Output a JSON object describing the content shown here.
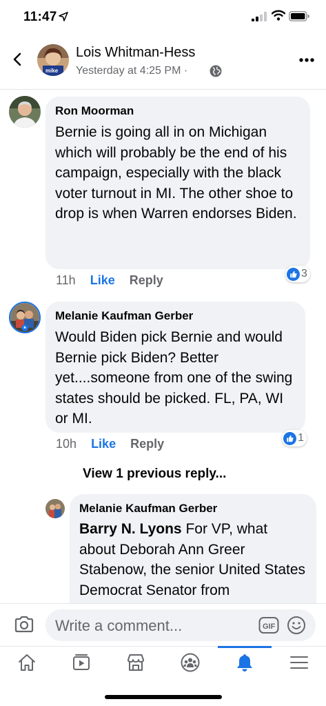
{
  "status_bar": {
    "time": "11:47"
  },
  "header": {
    "name": "Lois Whitman-Hess",
    "meta": "Yesterday at 4:25 PM ·",
    "avatar_caption": "mike"
  },
  "comments": [
    {
      "author": "Ron Moorman",
      "text": "Bernie is going all in on Michigan which will probably be the end of his campaign, especially with the black voter turnout in MI. The other shoe to\ndrop is when Warren endorses Biden.",
      "time": "11h",
      "like_label": "Like",
      "reply_label": "Reply",
      "reactions": "3"
    },
    {
      "author": "Melanie Kaufman Gerber",
      "text": "Would Biden pick Bernie and would Bernie pick Biden?  Better yet....someone from one of the swing states should be picked. FL, PA, WI or MI.",
      "time": "10h",
      "like_label": "Like",
      "reply_label": "Reply",
      "reactions": "1"
    }
  ],
  "view_previous": "View 1 previous reply...",
  "reply": {
    "author": "Melanie Kaufman Gerber",
    "mention": "Barry N. Lyons",
    "text": " For VP, what about Deborah Ann Greer Stabenow, the senior United States Democrat Senator from"
  },
  "composer": {
    "placeholder": "Write a comment..."
  },
  "tabbar": {
    "items": [
      "home-icon",
      "watch-icon",
      "marketplace-icon",
      "groups-icon",
      "notifications-icon",
      "menu-icon"
    ],
    "active": "notifications-icon"
  },
  "colors": {
    "accent": "#1b74e4",
    "bubble": "#f0f2f5",
    "secondary_text": "#65676b"
  }
}
